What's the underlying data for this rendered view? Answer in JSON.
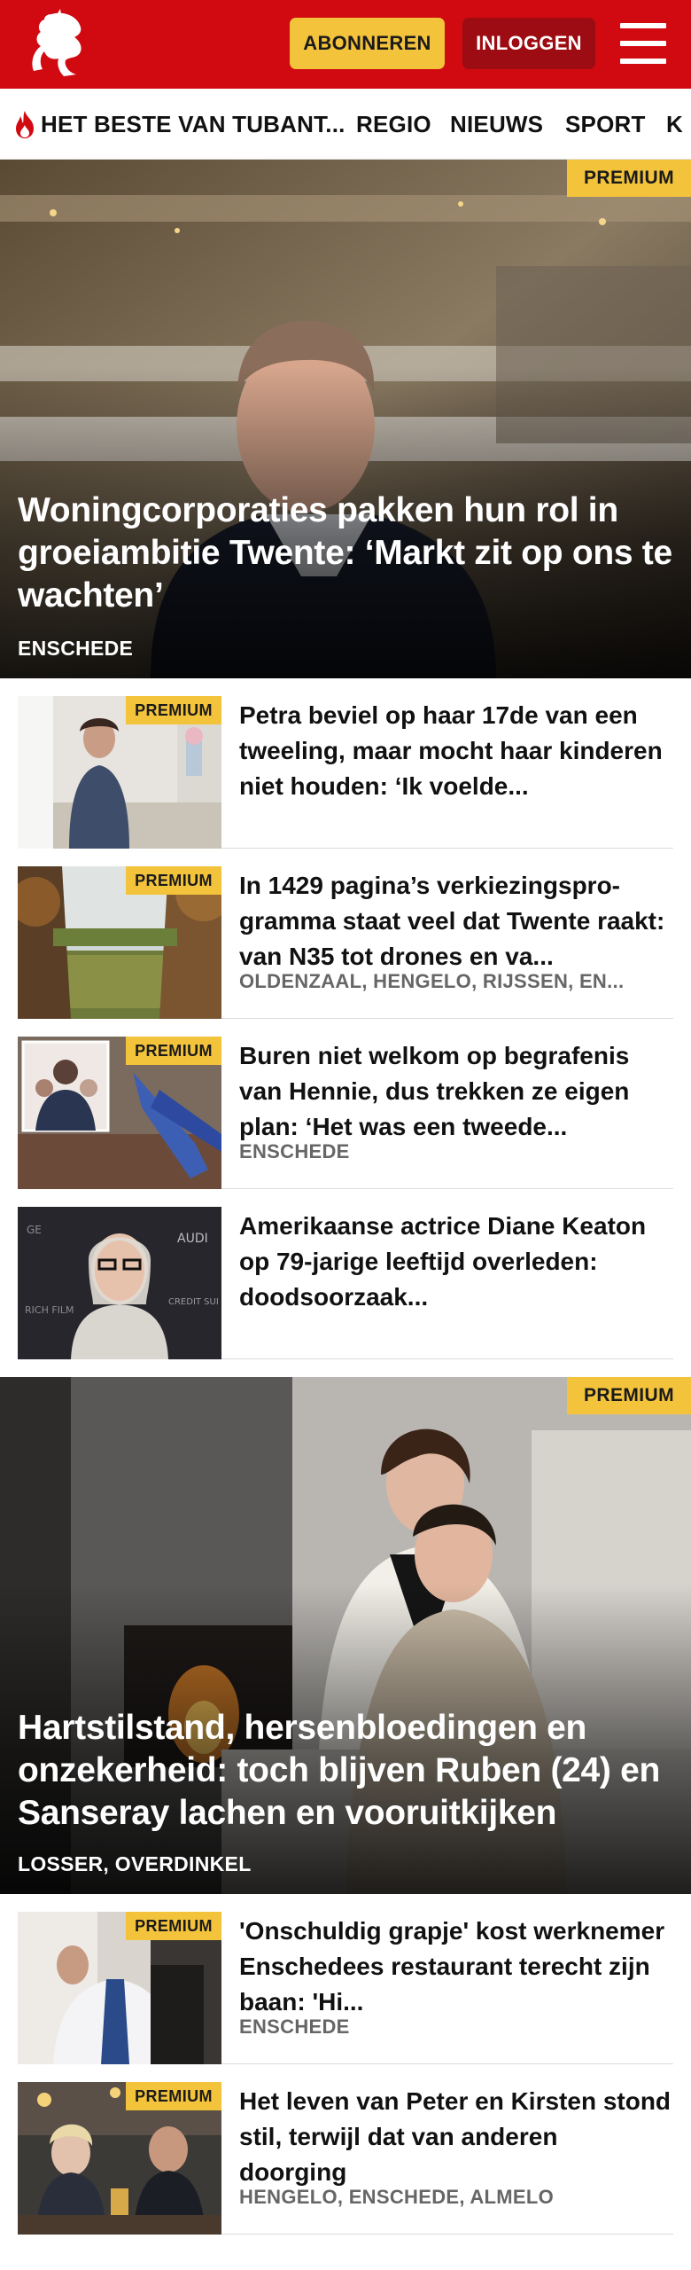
{
  "header": {
    "logo_icon": "tubantia-horse-logo",
    "subscribe_label": "ABONNEREN",
    "login_label": "INLOGGEN",
    "menu_icon": "hamburger-menu-icon"
  },
  "nav": {
    "items": [
      "HET BESTE VAN TUBANT...",
      "REGIO",
      "NIEUWS",
      "SPORT",
      "K"
    ]
  },
  "premium_label": "PREMIUM",
  "articles_top": {
    "hero": {
      "title": "Woningcorporaties pakken hun rol in groeiambitie Twente: ‘Markt zit op ons te wachten’",
      "location": "ENSCHEDE",
      "premium": true
    },
    "list": [
      {
        "title": "Petra beviel op haar 17de van een tweeling, maar mocht haar kinderen niet houden: ‘Ik voelde...",
        "location": "",
        "premium": true
      },
      {
        "title": "In 1429 pagina’s verkiezingspro-gramma staat veel dat Twente raakt: van N35 tot drones en va...",
        "location": "OLDENZAAL, HENGELO, RIJSSEN, EN...",
        "premium": true
      },
      {
        "title": "Buren niet welkom op begrafenis van Hennie, dus trekken ze eigen plan: ‘Het was een tweede...",
        "location": "ENSCHEDE",
        "premium": true
      },
      {
        "title": "Amerikaanse actrice Diane Keaton op 79-jarige leeftijd overleden: doodsoorzaak...",
        "location": "",
        "premium": false
      }
    ]
  },
  "articles_bottom": {
    "hero": {
      "title": "Hartstilstand, hersenbloedingen en onzekerheid: toch blijven Ruben (24) en Sanseray lachen en vooruitkijken",
      "location": "LOSSER, OVERDINKEL",
      "premium": true
    },
    "list": [
      {
        "title": "'Onschuldig grapje' kost werknemer Enschedees restaurant terecht zijn baan: 'Hi...",
        "location": "ENSCHEDE",
        "premium": true
      },
      {
        "title": "Het leven van Peter en Kirsten stond stil, terwijl dat van anderen doorging",
        "location": "HENGELO, ENSCHEDE, ALMELO",
        "premium": true
      }
    ]
  },
  "colors": {
    "brand_red": "#d10a11",
    "login_dark_red": "#9d0c12",
    "premium_yellow": "#f3c33b",
    "location_grey": "#666666"
  }
}
